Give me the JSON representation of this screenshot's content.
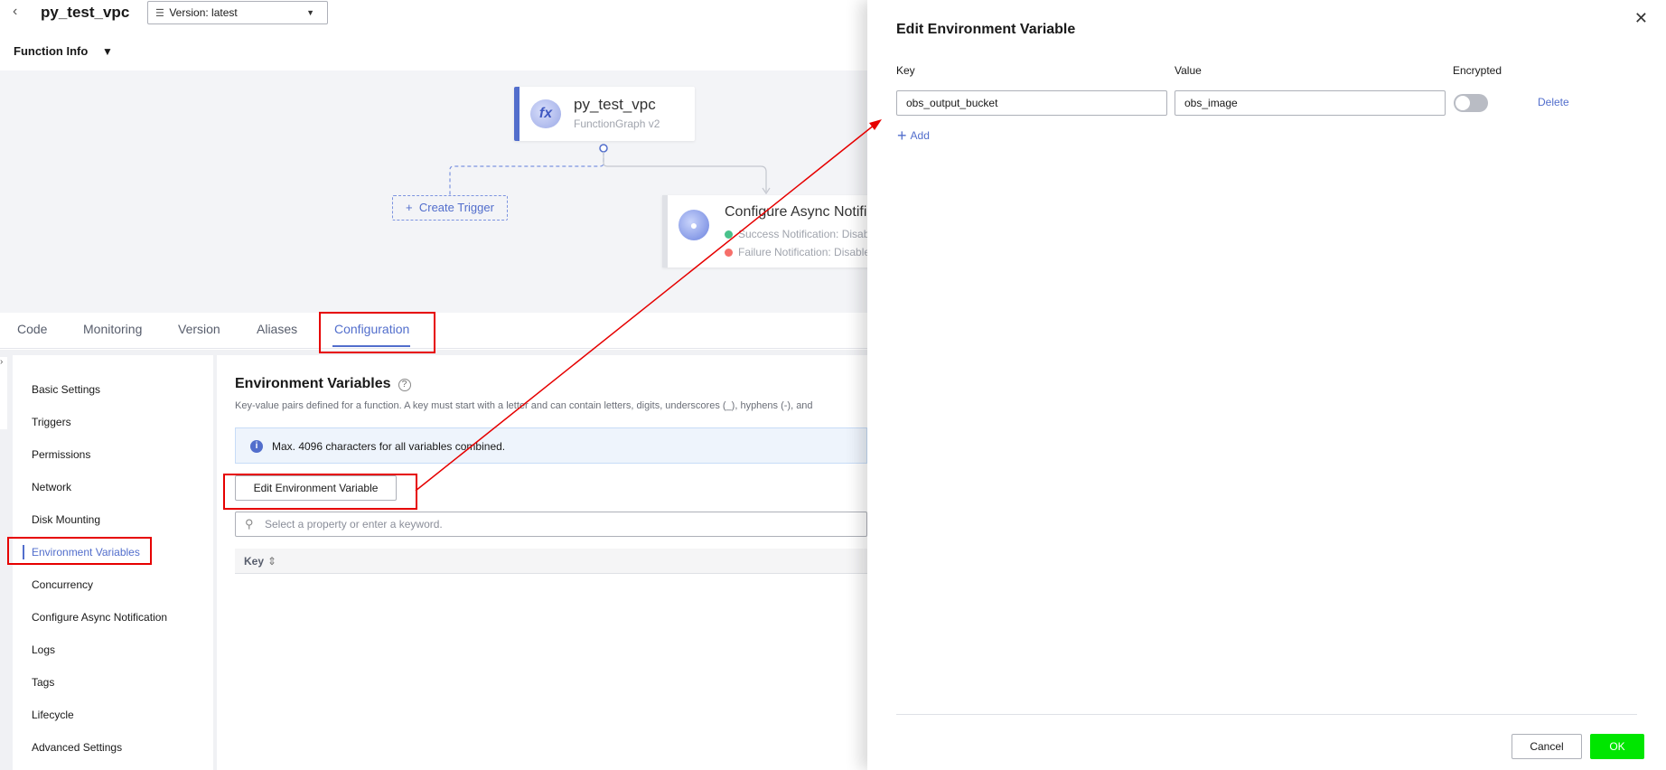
{
  "header": {
    "function_name": "py_test_vpc",
    "version_select": "Version: latest"
  },
  "function_info": {
    "label": "Function Info"
  },
  "canvas": {
    "function_node": {
      "name": "py_test_vpc",
      "runtime": "FunctionGraph v2",
      "icon": "fx-icon"
    },
    "create_trigger": "Create Trigger",
    "async_node": {
      "name": "Configure Async Notification",
      "success": "Success Notification: Disabled",
      "failure": "Failure Notification: Disabled"
    },
    "colors": {
      "success": "#49c18b",
      "failure": "#f66f6a"
    }
  },
  "tabs": [
    {
      "label": "Code"
    },
    {
      "label": "Monitoring"
    },
    {
      "label": "Version"
    },
    {
      "label": "Aliases"
    },
    {
      "label": "Configuration",
      "active": true
    }
  ],
  "sidebar": {
    "items": [
      {
        "label": "Basic Settings"
      },
      {
        "label": "Triggers"
      },
      {
        "label": "Permissions"
      },
      {
        "label": "Network"
      },
      {
        "label": "Disk Mounting"
      },
      {
        "label": "Environment Variables",
        "active": true
      },
      {
        "label": "Concurrency"
      },
      {
        "label": "Configure Async Notification"
      },
      {
        "label": "Logs"
      },
      {
        "label": "Tags"
      },
      {
        "label": "Lifecycle"
      },
      {
        "label": "Advanced Settings"
      }
    ]
  },
  "env": {
    "title": "Environment Variables",
    "description": "Key-value pairs defined for a function. A key must start with a letter and can contain letters, digits, underscores (_), hyphens (-), and",
    "info": "Max. 4096 characters for all variables combined.",
    "edit_button": "Edit Environment Variable",
    "search_placeholder": "Select a property or enter a keyword.",
    "table_columns": [
      "Key"
    ]
  },
  "drawer": {
    "title": "Edit Environment Variable",
    "columns": {
      "key": "Key",
      "value": "Value",
      "encrypted": "Encrypted"
    },
    "rows": [
      {
        "key": "obs_output_bucket",
        "value": "obs_image",
        "encrypted": false,
        "delete_label": "Delete"
      }
    ],
    "add_label": "Add",
    "cancel_label": "Cancel",
    "ok_label": "OK"
  },
  "theme": {
    "accent": "#526ecc",
    "annotation_red": "#e60000",
    "ok_green": "#00e600"
  }
}
